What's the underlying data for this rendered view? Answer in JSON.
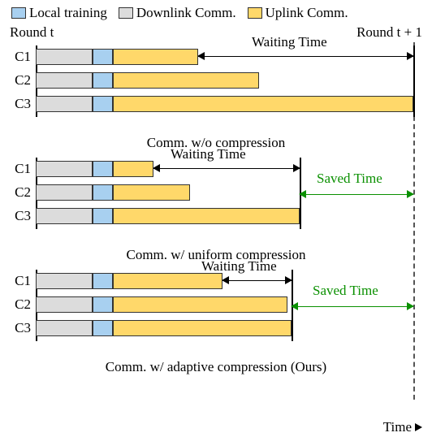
{
  "legend": {
    "local": "Local training",
    "downlink": "Downlink Comm.",
    "uplink": "Uplink Comm."
  },
  "round_labels": {
    "left": "Round t",
    "right": "Round t + 1"
  },
  "annotations": {
    "waiting_time": "Waiting Time",
    "saved_time": "Saved Time",
    "time_axis": "Time"
  },
  "captions": {
    "p1": "Comm. w/o compression",
    "p2": "Comm. w/ uniform compression",
    "p3": "Comm. w/ adaptive compression (Ours)"
  },
  "clients": {
    "c1": "C1",
    "c2": "C2",
    "c3": "C3"
  },
  "chart_data": [
    {
      "type": "bar",
      "title": "Comm. w/o compression",
      "xlabel": "Time",
      "ylabel": "",
      "categories": [
        "C1",
        "C2",
        "C3"
      ],
      "series": [
        {
          "name": "Downlink",
          "values": [
            70,
            70,
            70
          ]
        },
        {
          "name": "Local training",
          "values": [
            25,
            25,
            25
          ]
        },
        {
          "name": "Uplink",
          "values": [
            105,
            180,
            370
          ]
        }
      ],
      "end_time": 465,
      "round_end": 465,
      "waiting_time": {
        "client": "C1",
        "from": 200,
        "to": 465
      },
      "saved_time": null
    },
    {
      "type": "bar",
      "title": "Comm. w/ uniform compression",
      "xlabel": "Time",
      "ylabel": "",
      "categories": [
        "C1",
        "C2",
        "C3"
      ],
      "series": [
        {
          "name": "Downlink",
          "values": [
            70,
            70,
            70
          ]
        },
        {
          "name": "Local training",
          "values": [
            25,
            25,
            25
          ]
        },
        {
          "name": "Uplink",
          "values": [
            50,
            95,
            230
          ]
        }
      ],
      "end_time": 325,
      "round_end": 465,
      "waiting_time": {
        "client": "C1",
        "from": 145,
        "to": 325
      },
      "saved_time": {
        "from": 325,
        "to": 465
      }
    },
    {
      "type": "bar",
      "title": "Comm. w/ adaptive compression (Ours)",
      "xlabel": "Time",
      "ylabel": "",
      "categories": [
        "C1",
        "C2",
        "C3"
      ],
      "series": [
        {
          "name": "Downlink",
          "values": [
            70,
            70,
            70
          ]
        },
        {
          "name": "Local training",
          "values": [
            25,
            25,
            25
          ]
        },
        {
          "name": "Uplink",
          "values": [
            135,
            215,
            220
          ]
        }
      ],
      "end_time": 315,
      "round_end": 465,
      "waiting_time": {
        "client": "C1",
        "from": 230,
        "to": 315
      },
      "saved_time": {
        "from": 315,
        "to": 465
      }
    }
  ]
}
